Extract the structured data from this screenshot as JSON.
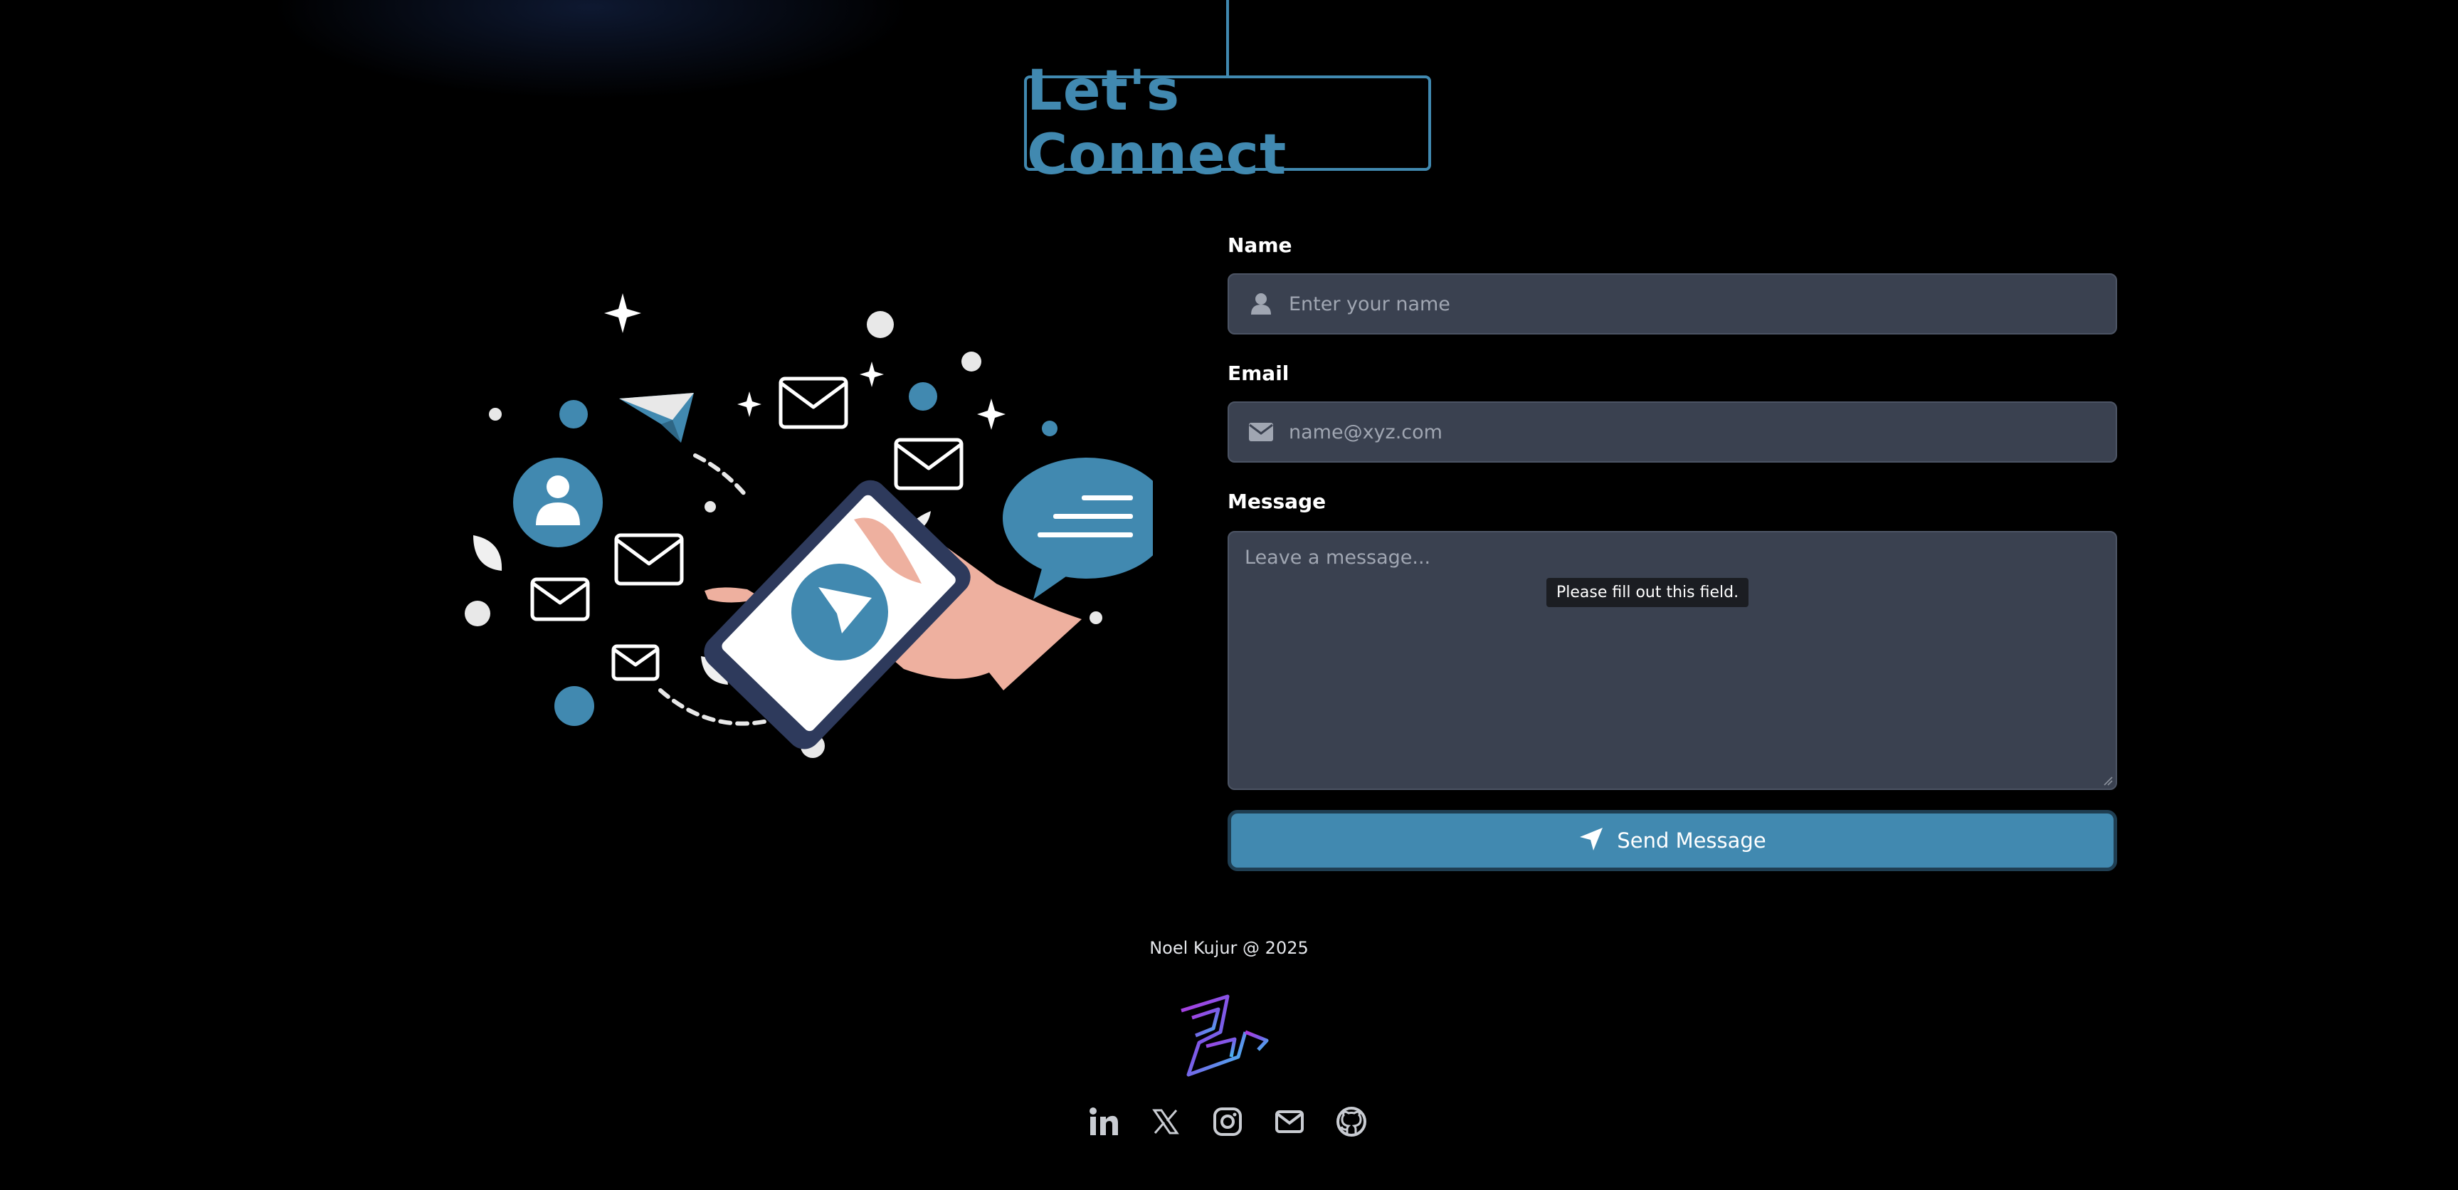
{
  "header": {
    "title": "Let's Connect"
  },
  "form": {
    "name_label": "Name",
    "name_placeholder": "Enter your name",
    "email_label": "Email",
    "email_placeholder": "name@xyz.com",
    "message_label": "Message",
    "message_placeholder": "Leave a message...",
    "validation_tooltip": "Please fill out this field.",
    "send_label": "Send Message"
  },
  "footer": {
    "credit": "Noel Kujur @ 2025",
    "social_icons": [
      "linkedin-icon",
      "x-icon",
      "instagram-icon",
      "mail-icon",
      "github-icon"
    ]
  },
  "colors": {
    "accent": "#4189b0",
    "input_bg": "#3a4150",
    "page_bg": "#000000",
    "hand": "#eeb09f",
    "phone_frame": "#2e3a5c"
  }
}
